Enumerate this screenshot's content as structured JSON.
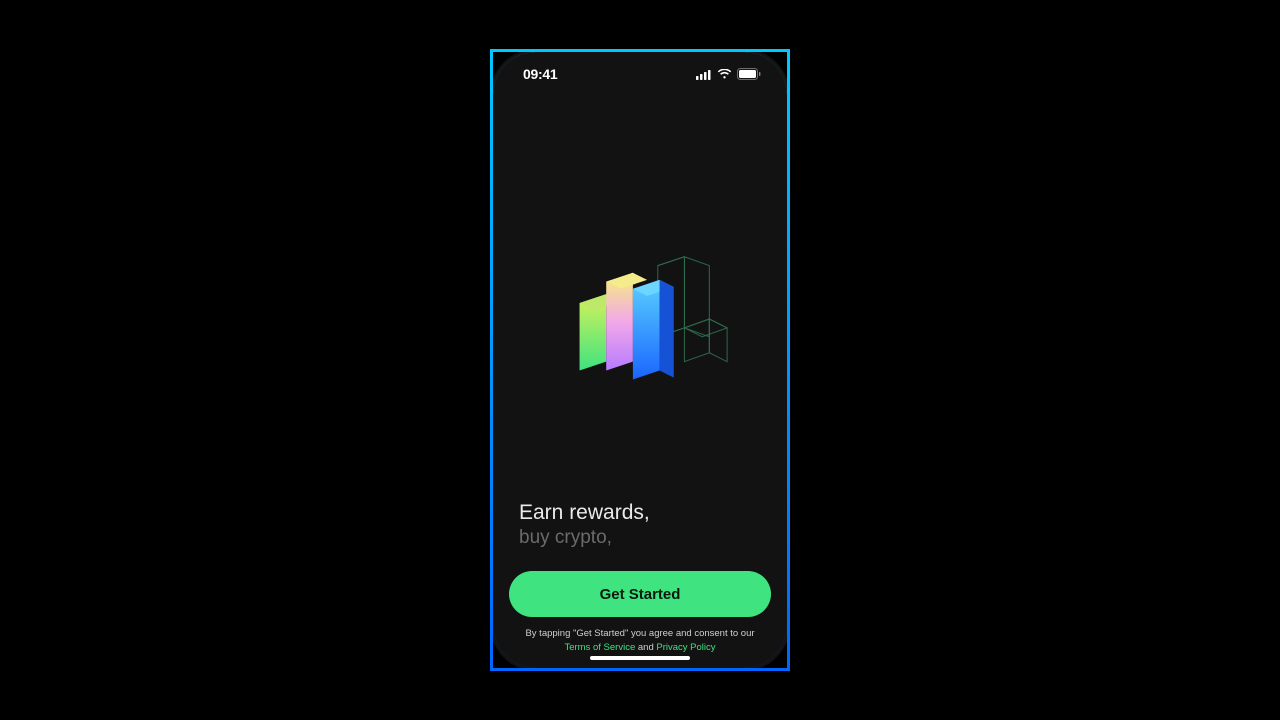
{
  "status": {
    "time": "09:41"
  },
  "tagline": {
    "line1": "Earn rewards,",
    "line2": "buy crypto,"
  },
  "cta": {
    "label": "Get Started"
  },
  "legal": {
    "prefix": "By tapping \"Get Started\" you agree and consent to our",
    "terms": "Terms of Service",
    "and": " and ",
    "privacy": "Privacy Policy"
  }
}
